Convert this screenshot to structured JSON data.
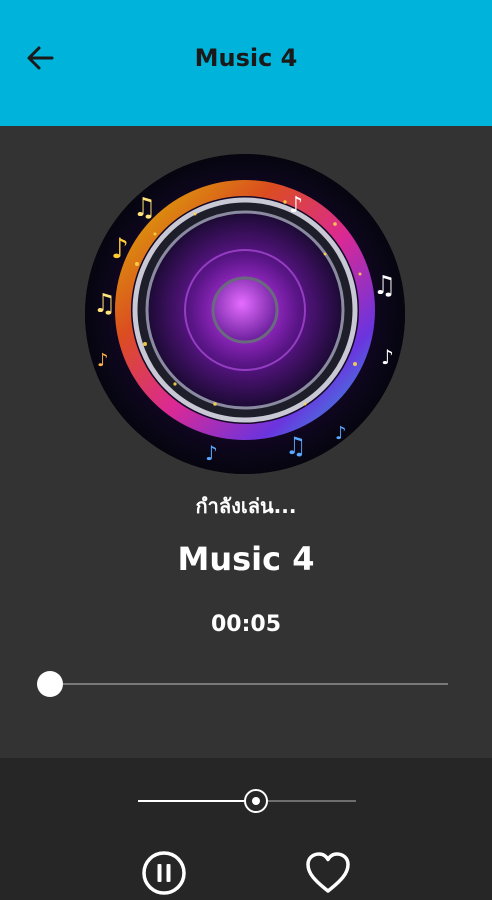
{
  "header": {
    "title": "Music 4",
    "back_icon": "arrow-left-icon",
    "background": "#00b3db"
  },
  "player": {
    "artwork": "speaker-music-notes-artwork",
    "status": "กำลังเล่น...",
    "track_title": "Music 4",
    "elapsed": "00:05",
    "progress_fraction": 0.0,
    "volume_fraction": 0.54
  },
  "controls": {
    "pause_icon": "pause-circle-icon",
    "favorite_icon": "heart-outline-icon"
  }
}
